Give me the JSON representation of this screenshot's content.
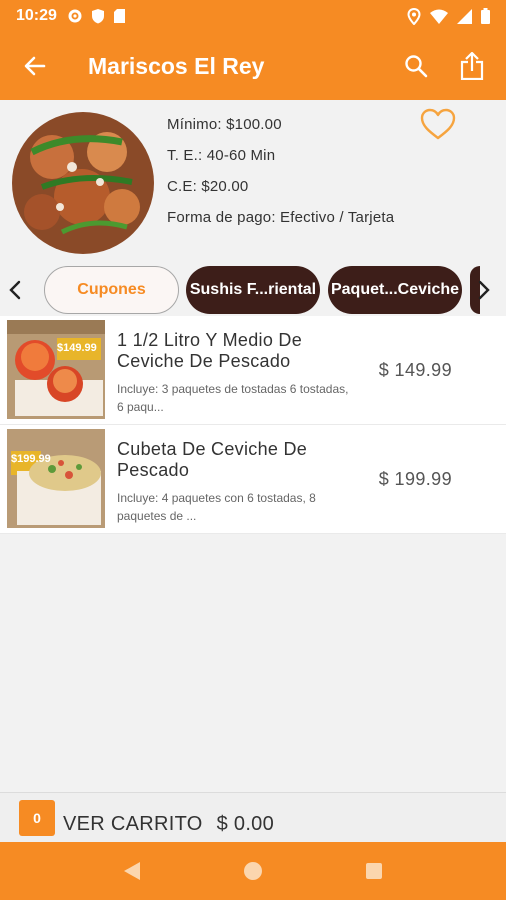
{
  "status_bar": {
    "time": "10:29"
  },
  "header": {
    "title": "Mariscos El Rey"
  },
  "restaurant": {
    "minimum": "Mínimo: $100.00",
    "time_estimate": "T. E.: 40-60 Min",
    "delivery_cost": "C.E: $20.00",
    "payment": "Forma de pago: Efectivo / Tarjeta"
  },
  "tabs": [
    {
      "label": "Cupones",
      "active": true
    },
    {
      "label": "Sushis F...riental",
      "active": false
    },
    {
      "label": "Paquet...Ceviche",
      "active": false
    }
  ],
  "items": [
    {
      "name": "1 1/2 Litro Y Medio De Ceviche De Pescado",
      "description": "Incluye: 3 paquetes de tostadas 6 tostadas, 6 paqu...",
      "price": "$ 149.99",
      "thumb_badge": "$149.99"
    },
    {
      "name": "Cubeta De Ceviche De Pescado",
      "description": "Incluye: 4 paquetes con 6 tostadas, 8 paquetes de ...",
      "price": "$ 199.99",
      "thumb_badge": "$199.99"
    }
  ],
  "cart": {
    "count": "0",
    "label": "VER CARRITO",
    "total": "$ 0.00"
  },
  "colors": {
    "primary": "#f68b23",
    "tab_dark": "#3d1e19",
    "background": "#f2f2f2"
  },
  "icons": [
    "back-arrow-icon",
    "search-icon",
    "share-icon",
    "heart-icon",
    "chevron-left-icon",
    "chevron-right-icon",
    "nav-back-icon",
    "nav-home-icon",
    "nav-recents-icon"
  ]
}
